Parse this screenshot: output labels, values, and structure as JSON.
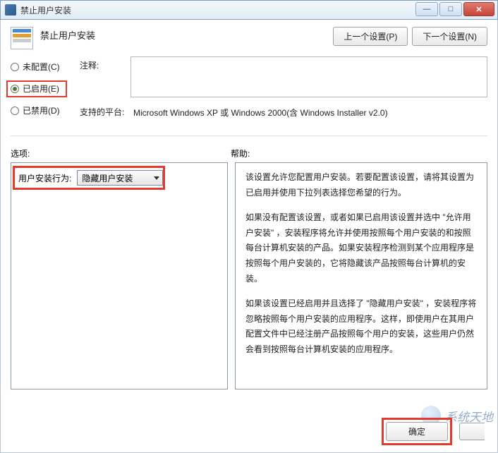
{
  "titlebar": {
    "title": "禁止用户安装"
  },
  "header": {
    "title": "禁止用户安装",
    "prev_setting": "上一个设置(P)",
    "next_setting": "下一个设置(N)"
  },
  "radios": {
    "not_configured": "未配置(C)",
    "enabled": "已启用(E)",
    "disabled": "已禁用(D)",
    "selected": "enabled"
  },
  "fields": {
    "comment_label": "注释:",
    "comment_value": "",
    "platform_label": "支持的平台:",
    "platform_value": "Microsoft Windows XP 或 Windows 2000(含 Windows Installer v2.0)"
  },
  "section_labels": {
    "options": "选项:",
    "help": "帮助:"
  },
  "options": {
    "behavior_label": "用户安装行为:",
    "behavior_value": "隐藏用户安装"
  },
  "help": {
    "p1": "该设置允许您配置用户安装。若要配置该设置，请将其设置为已启用并使用下拉列表选择您希望的行为。",
    "p2": "如果没有配置该设置，或者如果已启用该设置并选中 \"允许用户安装\" ，安装程序将允许并使用按照每个用户安装的和按照每台计算机安装的产品。如果安装程序检测到某个应用程序是按照每个用户安装的，它将隐藏该产品按照每台计算机的安装。",
    "p3": "如果该设置已经启用并且选择了 \"隐藏用户安装\" ，安装程序将忽略按照每个用户安装的应用程序。这样，即使用户在其用户配置文件中已经注册产品按照每个用户的安装，这些用户仍然会看到按照每台计算机安装的应用程序。"
  },
  "footer": {
    "ok": "确定"
  },
  "watermark": {
    "text": "系统天地"
  }
}
